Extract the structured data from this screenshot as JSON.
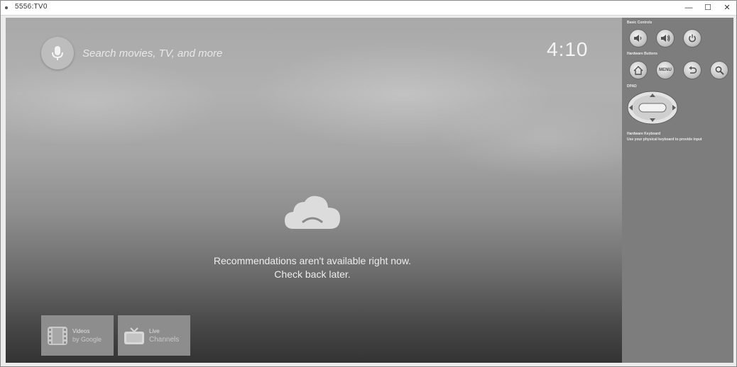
{
  "window": {
    "title": "5556:TV0",
    "controls": {
      "minimize": "—",
      "maximize": "☐",
      "close": "✕"
    }
  },
  "tv": {
    "search_hint": "Search movies, TV, and more",
    "clock": "4:10",
    "empty_state": {
      "line1": "Recommendations aren't available right now.",
      "line2": "Check back later."
    },
    "apps": [
      {
        "name": "Videos",
        "sub": "by Google",
        "icon": "film-icon"
      },
      {
        "name": "Live",
        "sub": "Channels",
        "icon": "tv-icon"
      }
    ]
  },
  "control_panel": {
    "basic_controls_label": "Basic Controls",
    "hardware_buttons_label": "Hardware Buttons",
    "dpad_label": "DPAD",
    "keyboard_label": "Hardware Keyboard",
    "keyboard_hint": "Use your physical keyboard to provide input",
    "menu_label": "MENU"
  },
  "colors": {
    "panel_bg": "#7d7d7d",
    "tile_bg": "#8d8d8d",
    "button_face": "#d8d8d8"
  }
}
